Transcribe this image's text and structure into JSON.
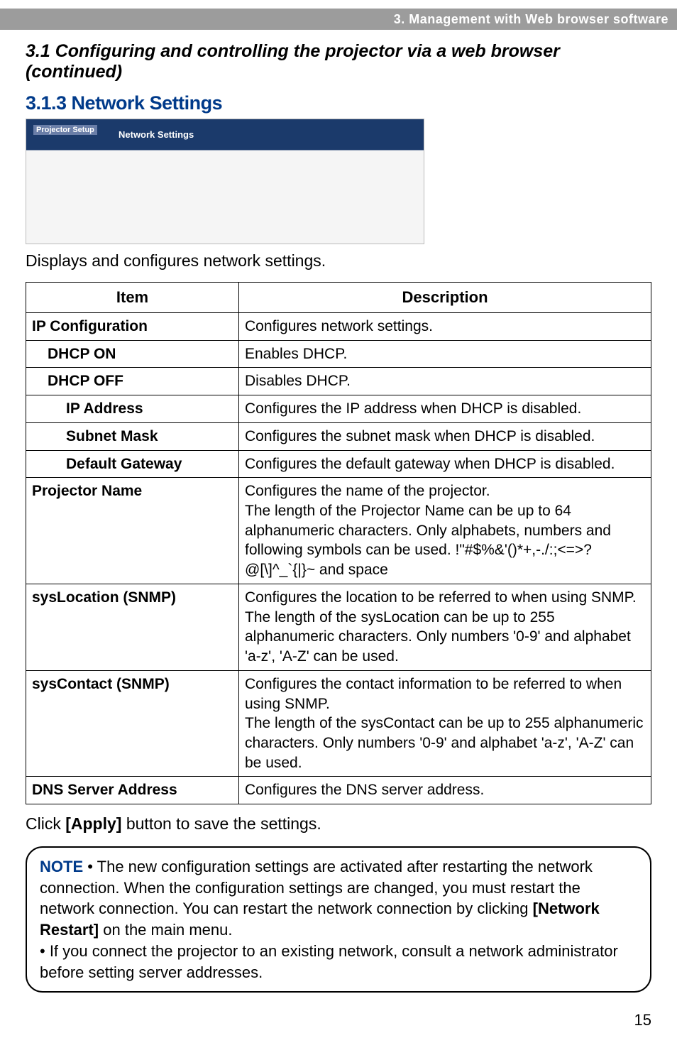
{
  "header": {
    "breadcrumb": "3. Management with Web browser software"
  },
  "titles": {
    "section": "3.1 Configuring and controlling the projector via a web browser (continued)",
    "subsection": "3.1.3 Network Settings"
  },
  "screenshot": {
    "status_label": "Projector Setup",
    "window_title": "Network Settings"
  },
  "descriptions": {
    "intro": "Displays and configures network settings.",
    "click_apply_prefix": "Click ",
    "click_apply_bold": "[Apply]",
    "click_apply_suffix": " button to save the settings."
  },
  "table": {
    "header_item": "Item",
    "header_desc": "Description",
    "rows": [
      {
        "item": "IP Configuration",
        "desc": "Configures network settings.",
        "indent": 0
      },
      {
        "item": "DHCP ON",
        "desc": "Enables DHCP.",
        "indent": 1
      },
      {
        "item": "DHCP OFF",
        "desc": "Disables DHCP.",
        "indent": 1
      },
      {
        "item": "IP Address",
        "desc": "Configures the IP address when DHCP is disabled.",
        "indent": 2
      },
      {
        "item": "Subnet Mask",
        "desc": "Configures the subnet mask when DHCP is disabled.",
        "indent": 2
      },
      {
        "item": "Default Gateway",
        "desc": "Configures the default gateway when DHCP is disabled.",
        "indent": 2
      },
      {
        "item": "Projector Name",
        "desc": "Configures the name of the projector.\nThe length of the Projector Name can be up to 64 alphanumeric characters. Only alphabets, numbers and following symbols can be used.  !\"#$%&'()*+,-./:;<=>?@[\\]^_`{|}~ and space",
        "indent": 0
      },
      {
        "item": "sysLocation (SNMP)",
        "desc": "Configures the location to be referred to when using SNMP. The length of the sysLocation can be up to 255 alphanumeric characters. Only numbers '0-9' and alphabet 'a-z', 'A-Z' can be used.",
        "indent": 0
      },
      {
        "item": "sysContact (SNMP)",
        "desc": "Configures the contact information to be referred to when using SNMP.\nThe length of the sysContact can be up to 255 alphanumeric characters. Only numbers '0-9' and alphabet 'a-z', 'A-Z' can be used.",
        "indent": 0
      },
      {
        "item": "DNS Server Address",
        "desc": "Configures the DNS  server address.",
        "indent": 0
      }
    ]
  },
  "note": {
    "label": "NOTE",
    "body1": "  • The new configuration settings are activated after restarting the network connection. When the configuration settings are changed, you must restart the network connection. You can restart the network connection by clicking ",
    "bold1": "[Network Restart]",
    "body1_suffix": " on the main menu.",
    "body2": "• If you connect the projector to an existing network, consult a network administrator before setting server addresses."
  },
  "page": "15"
}
